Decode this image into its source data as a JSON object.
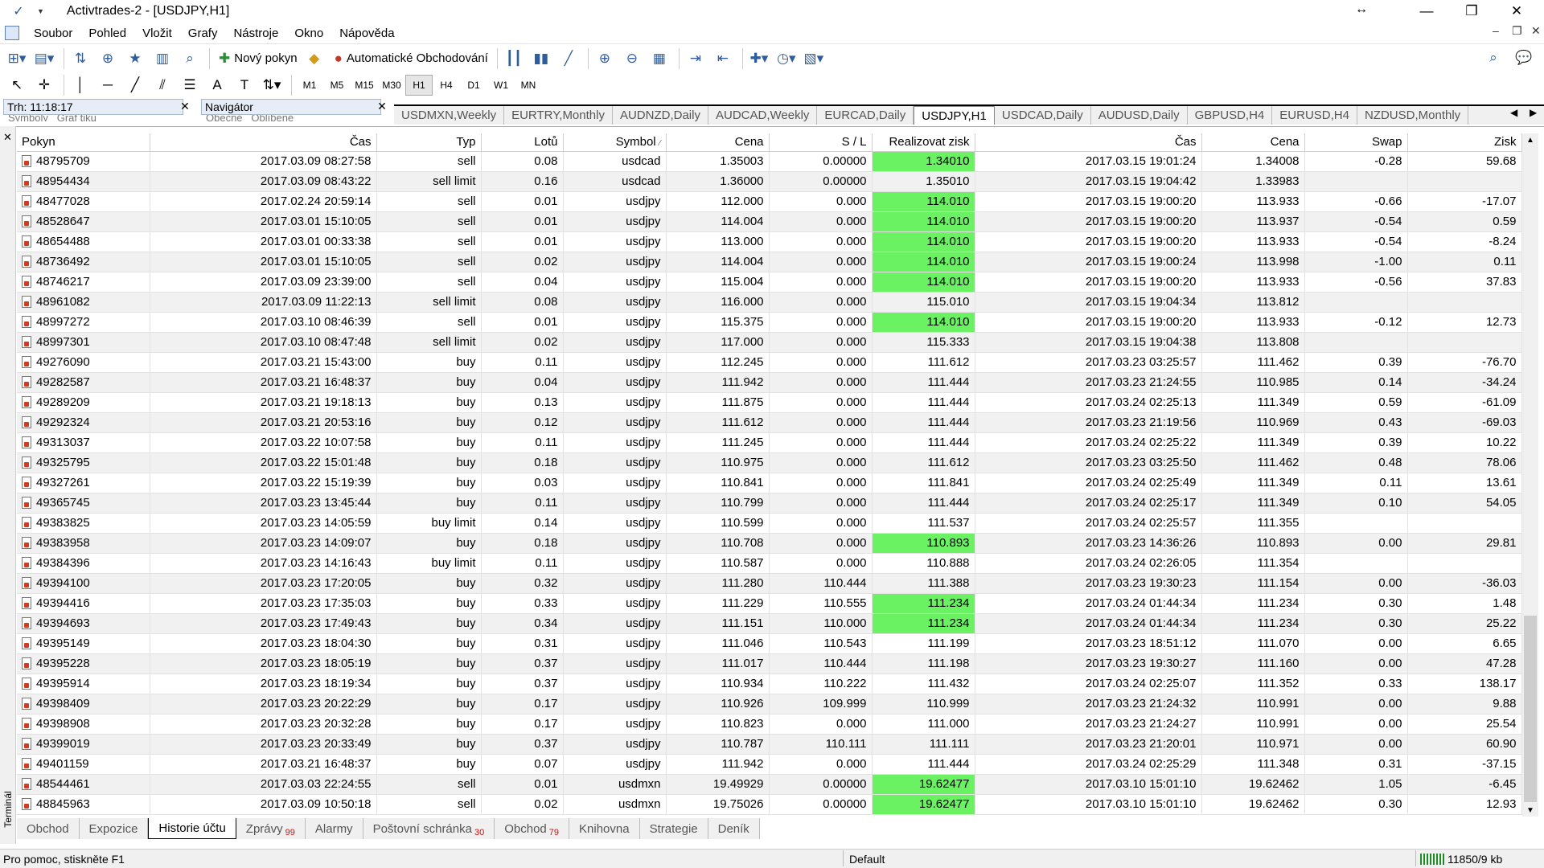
{
  "window": {
    "title": "Activtrades-2 - [USDJPY,H1]"
  },
  "menu": [
    "Soubor",
    "Pohled",
    "Vložit",
    "Grafy",
    "Nástroje",
    "Okno",
    "Nápověda"
  ],
  "toolbar": {
    "new_order": "Nový pokyn",
    "auto_trading": "Automatické Obchodování"
  },
  "timeframes": [
    "M1",
    "M5",
    "M15",
    "M30",
    "H1",
    "H4",
    "D1",
    "W1",
    "MN"
  ],
  "active_timeframe": "H1",
  "panels": {
    "market_watch": {
      "title": "Trh: 11:18:17",
      "tabs": [
        "Symboly",
        "Graf tiku"
      ]
    },
    "navigator": {
      "title": "Navigátor",
      "tabs": [
        "Obecné",
        "Oblíbené"
      ]
    }
  },
  "chart_tabs": [
    "USDMXN,Weekly",
    "EURTRY,Monthly",
    "AUDNZD,Daily",
    "AUDCAD,Weekly",
    "EURCAD,Daily",
    "USDJPY,H1",
    "USDCAD,Daily",
    "AUDUSD,Daily",
    "GBPUSD,H4",
    "EURUSD,H4",
    "NZDUSD,Monthly"
  ],
  "active_chart_tab": "USDJPY,H1",
  "table": {
    "headers": [
      "Pokyn",
      "Čas",
      "Typ",
      "Lotů",
      "Symbol",
      "Cena",
      "S / L",
      "Realizovat zisk",
      "Čas",
      "Cena",
      "Swap",
      "Zisk"
    ],
    "rows": [
      {
        "pokyn": "48795709",
        "cas": "2017.03.09 08:27:58",
        "typ": "sell",
        "lotu": "0.08",
        "symbol": "usdcad",
        "cena": "1.35003",
        "sl": "0.00000",
        "tp": "1.34010",
        "tp_hit": true,
        "cas2": "2017.03.15 19:01:24",
        "cena2": "1.34008",
        "swap": "-0.28",
        "zisk": "59.68"
      },
      {
        "pokyn": "48954434",
        "cas": "2017.03.09 08:43:22",
        "typ": "sell limit",
        "lotu": "0.16",
        "symbol": "usdcad",
        "cena": "1.36000",
        "sl": "0.00000",
        "tp": "1.35010",
        "tp_hit": false,
        "cas2": "2017.03.15 19:04:42",
        "cena2": "1.33983",
        "swap": "",
        "zisk": ""
      },
      {
        "pokyn": "48477028",
        "cas": "2017.02.24 20:59:14",
        "typ": "sell",
        "lotu": "0.01",
        "symbol": "usdjpy",
        "cena": "112.000",
        "sl": "0.000",
        "tp": "114.010",
        "tp_hit": true,
        "cas2": "2017.03.15 19:00:20",
        "cena2": "113.933",
        "swap": "-0.66",
        "zisk": "-17.07"
      },
      {
        "pokyn": "48528647",
        "cas": "2017.03.01 15:10:05",
        "typ": "sell",
        "lotu": "0.01",
        "symbol": "usdjpy",
        "cena": "114.004",
        "sl": "0.000",
        "tp": "114.010",
        "tp_hit": true,
        "cas2": "2017.03.15 19:00:20",
        "cena2": "113.937",
        "swap": "-0.54",
        "zisk": "0.59"
      },
      {
        "pokyn": "48654488",
        "cas": "2017.03.01 00:33:38",
        "typ": "sell",
        "lotu": "0.01",
        "symbol": "usdjpy",
        "cena": "113.000",
        "sl": "0.000",
        "tp": "114.010",
        "tp_hit": true,
        "cas2": "2017.03.15 19:00:20",
        "cena2": "113.933",
        "swap": "-0.54",
        "zisk": "-8.24"
      },
      {
        "pokyn": "48736492",
        "cas": "2017.03.01 15:10:05",
        "typ": "sell",
        "lotu": "0.02",
        "symbol": "usdjpy",
        "cena": "114.004",
        "sl": "0.000",
        "tp": "114.010",
        "tp_hit": true,
        "cas2": "2017.03.15 19:00:24",
        "cena2": "113.998",
        "swap": "-1.00",
        "zisk": "0.11"
      },
      {
        "pokyn": "48746217",
        "cas": "2017.03.09 23:39:00",
        "typ": "sell",
        "lotu": "0.04",
        "symbol": "usdjpy",
        "cena": "115.004",
        "sl": "0.000",
        "tp": "114.010",
        "tp_hit": true,
        "cas2": "2017.03.15 19:00:20",
        "cena2": "113.933",
        "swap": "-0.56",
        "zisk": "37.83"
      },
      {
        "pokyn": "48961082",
        "cas": "2017.03.09 11:22:13",
        "typ": "sell limit",
        "lotu": "0.08",
        "symbol": "usdjpy",
        "cena": "116.000",
        "sl": "0.000",
        "tp": "115.010",
        "tp_hit": false,
        "cas2": "2017.03.15 19:04:34",
        "cena2": "113.812",
        "swap": "",
        "zisk": ""
      },
      {
        "pokyn": "48997272",
        "cas": "2017.03.10 08:46:39",
        "typ": "sell",
        "lotu": "0.01",
        "symbol": "usdjpy",
        "cena": "115.375",
        "sl": "0.000",
        "tp": "114.010",
        "tp_hit": true,
        "cas2": "2017.03.15 19:00:20",
        "cena2": "113.933",
        "swap": "-0.12",
        "zisk": "12.73"
      },
      {
        "pokyn": "48997301",
        "cas": "2017.03.10 08:47:48",
        "typ": "sell limit",
        "lotu": "0.02",
        "symbol": "usdjpy",
        "cena": "117.000",
        "sl": "0.000",
        "tp": "115.333",
        "tp_hit": false,
        "cas2": "2017.03.15 19:04:38",
        "cena2": "113.808",
        "swap": "",
        "zisk": ""
      },
      {
        "pokyn": "49276090",
        "cas": "2017.03.21 15:43:00",
        "typ": "buy",
        "lotu": "0.11",
        "symbol": "usdjpy",
        "cena": "112.245",
        "sl": "0.000",
        "tp": "111.612",
        "tp_hit": false,
        "cas2": "2017.03.23 03:25:57",
        "cena2": "111.462",
        "swap": "0.39",
        "zisk": "-76.70"
      },
      {
        "pokyn": "49282587",
        "cas": "2017.03.21 16:48:37",
        "typ": "buy",
        "lotu": "0.04",
        "symbol": "usdjpy",
        "cena": "111.942",
        "sl": "0.000",
        "tp": "111.444",
        "tp_hit": false,
        "cas2": "2017.03.23 21:24:55",
        "cena2": "110.985",
        "swap": "0.14",
        "zisk": "-34.24"
      },
      {
        "pokyn": "49289209",
        "cas": "2017.03.21 19:18:13",
        "typ": "buy",
        "lotu": "0.13",
        "symbol": "usdjpy",
        "cena": "111.875",
        "sl": "0.000",
        "tp": "111.444",
        "tp_hit": false,
        "cas2": "2017.03.24 02:25:13",
        "cena2": "111.349",
        "swap": "0.59",
        "zisk": "-61.09"
      },
      {
        "pokyn": "49292324",
        "cas": "2017.03.21 20:53:16",
        "typ": "buy",
        "lotu": "0.12",
        "symbol": "usdjpy",
        "cena": "111.612",
        "sl": "0.000",
        "tp": "111.444",
        "tp_hit": false,
        "cas2": "2017.03.23 21:19:56",
        "cena2": "110.969",
        "swap": "0.43",
        "zisk": "-69.03"
      },
      {
        "pokyn": "49313037",
        "cas": "2017.03.22 10:07:58",
        "typ": "buy",
        "lotu": "0.11",
        "symbol": "usdjpy",
        "cena": "111.245",
        "sl": "0.000",
        "tp": "111.444",
        "tp_hit": false,
        "cas2": "2017.03.24 02:25:22",
        "cena2": "111.349",
        "swap": "0.39",
        "zisk": "10.22"
      },
      {
        "pokyn": "49325795",
        "cas": "2017.03.22 15:01:48",
        "typ": "buy",
        "lotu": "0.18",
        "symbol": "usdjpy",
        "cena": "110.975",
        "sl": "0.000",
        "tp": "111.612",
        "tp_hit": false,
        "cas2": "2017.03.23 03:25:50",
        "cena2": "111.462",
        "swap": "0.48",
        "zisk": "78.06"
      },
      {
        "pokyn": "49327261",
        "cas": "2017.03.22 15:19:39",
        "typ": "buy",
        "lotu": "0.03",
        "symbol": "usdjpy",
        "cena": "110.841",
        "sl": "0.000",
        "tp": "111.841",
        "tp_hit": false,
        "cas2": "2017.03.24 02:25:49",
        "cena2": "111.349",
        "swap": "0.11",
        "zisk": "13.61"
      },
      {
        "pokyn": "49365745",
        "cas": "2017.03.23 13:45:44",
        "typ": "buy",
        "lotu": "0.11",
        "symbol": "usdjpy",
        "cena": "110.799",
        "sl": "0.000",
        "tp": "111.444",
        "tp_hit": false,
        "cas2": "2017.03.24 02:25:17",
        "cena2": "111.349",
        "swap": "0.10",
        "zisk": "54.05"
      },
      {
        "pokyn": "49383825",
        "cas": "2017.03.23 14:05:59",
        "typ": "buy limit",
        "lotu": "0.14",
        "symbol": "usdjpy",
        "cena": "110.599",
        "sl": "0.000",
        "tp": "111.537",
        "tp_hit": false,
        "cas2": "2017.03.24 02:25:57",
        "cena2": "111.355",
        "swap": "",
        "zisk": ""
      },
      {
        "pokyn": "49383958",
        "cas": "2017.03.23 14:09:07",
        "typ": "buy",
        "lotu": "0.18",
        "symbol": "usdjpy",
        "cena": "110.708",
        "sl": "0.000",
        "tp": "110.893",
        "tp_hit": true,
        "cas2": "2017.03.23 14:36:26",
        "cena2": "110.893",
        "swap": "0.00",
        "zisk": "29.81"
      },
      {
        "pokyn": "49384396",
        "cas": "2017.03.23 14:16:43",
        "typ": "buy limit",
        "lotu": "0.11",
        "symbol": "usdjpy",
        "cena": "110.587",
        "sl": "0.000",
        "tp": "110.888",
        "tp_hit": false,
        "cas2": "2017.03.24 02:26:05",
        "cena2": "111.354",
        "swap": "",
        "zisk": ""
      },
      {
        "pokyn": "49394100",
        "cas": "2017.03.23 17:20:05",
        "typ": "buy",
        "lotu": "0.32",
        "symbol": "usdjpy",
        "cena": "111.280",
        "sl": "110.444",
        "tp": "111.388",
        "tp_hit": false,
        "cas2": "2017.03.23 19:30:23",
        "cena2": "111.154",
        "swap": "0.00",
        "zisk": "-36.03"
      },
      {
        "pokyn": "49394416",
        "cas": "2017.03.23 17:35:03",
        "typ": "buy",
        "lotu": "0.33",
        "symbol": "usdjpy",
        "cena": "111.229",
        "sl": "110.555",
        "tp": "111.234",
        "tp_hit": true,
        "cas2": "2017.03.24 01:44:34",
        "cena2": "111.234",
        "swap": "0.30",
        "zisk": "1.48"
      },
      {
        "pokyn": "49394693",
        "cas": "2017.03.23 17:49:43",
        "typ": "buy",
        "lotu": "0.34",
        "symbol": "usdjpy",
        "cena": "111.151",
        "sl": "110.000",
        "tp": "111.234",
        "tp_hit": true,
        "cas2": "2017.03.24 01:44:34",
        "cena2": "111.234",
        "swap": "0.30",
        "zisk": "25.22"
      },
      {
        "pokyn": "49395149",
        "cas": "2017.03.23 18:04:30",
        "typ": "buy",
        "lotu": "0.31",
        "symbol": "usdjpy",
        "cena": "111.046",
        "sl": "110.543",
        "tp": "111.199",
        "tp_hit": false,
        "cas2": "2017.03.23 18:51:12",
        "cena2": "111.070",
        "swap": "0.00",
        "zisk": "6.65"
      },
      {
        "pokyn": "49395228",
        "cas": "2017.03.23 18:05:19",
        "typ": "buy",
        "lotu": "0.37",
        "symbol": "usdjpy",
        "cena": "111.017",
        "sl": "110.444",
        "tp": "111.198",
        "tp_hit": false,
        "cas2": "2017.03.23 19:30:27",
        "cena2": "111.160",
        "swap": "0.00",
        "zisk": "47.28"
      },
      {
        "pokyn": "49395914",
        "cas": "2017.03.23 18:19:34",
        "typ": "buy",
        "lotu": "0.37",
        "symbol": "usdjpy",
        "cena": "110.934",
        "sl": "110.222",
        "tp": "111.432",
        "tp_hit": false,
        "cas2": "2017.03.24 02:25:07",
        "cena2": "111.352",
        "swap": "0.33",
        "zisk": "138.17"
      },
      {
        "pokyn": "49398409",
        "cas": "2017.03.23 20:22:29",
        "typ": "buy",
        "lotu": "0.17",
        "symbol": "usdjpy",
        "cena": "110.926",
        "sl": "109.999",
        "tp": "110.999",
        "tp_hit": false,
        "cas2": "2017.03.23 21:24:32",
        "cena2": "110.991",
        "swap": "0.00",
        "zisk": "9.88"
      },
      {
        "pokyn": "49398908",
        "cas": "2017.03.23 20:32:28",
        "typ": "buy",
        "lotu": "0.17",
        "symbol": "usdjpy",
        "cena": "110.823",
        "sl": "0.000",
        "tp": "111.000",
        "tp_hit": false,
        "cas2": "2017.03.23 21:24:27",
        "cena2": "110.991",
        "swap": "0.00",
        "zisk": "25.54"
      },
      {
        "pokyn": "49399019",
        "cas": "2017.03.23 20:33:49",
        "typ": "buy",
        "lotu": "0.37",
        "symbol": "usdjpy",
        "cena": "110.787",
        "sl": "110.111",
        "tp": "111.111",
        "tp_hit": false,
        "cas2": "2017.03.23 21:20:01",
        "cena2": "110.971",
        "swap": "0.00",
        "zisk": "60.90"
      },
      {
        "pokyn": "49401159",
        "cas": "2017.03.21 16:48:37",
        "typ": "buy",
        "lotu": "0.07",
        "symbol": "usdjpy",
        "cena": "111.942",
        "sl": "0.000",
        "tp": "111.444",
        "tp_hit": false,
        "cas2": "2017.03.24 02:25:29",
        "cena2": "111.348",
        "swap": "0.31",
        "zisk": "-37.15"
      },
      {
        "pokyn": "48544461",
        "cas": "2017.03.03 22:24:55",
        "typ": "sell",
        "lotu": "0.01",
        "symbol": "usdmxn",
        "cena": "19.49929",
        "sl": "0.00000",
        "tp": "19.62477",
        "tp_hit": true,
        "cas2": "2017.03.10 15:01:10",
        "cena2": "19.62462",
        "swap": "1.05",
        "zisk": "-6.45"
      },
      {
        "pokyn": "48845963",
        "cas": "2017.03.09 10:50:18",
        "typ": "sell",
        "lotu": "0.02",
        "symbol": "usdmxn",
        "cena": "19.75026",
        "sl": "0.00000",
        "tp": "19.62477",
        "tp_hit": true,
        "cas2": "2017.03.10 15:01:10",
        "cena2": "19.62462",
        "swap": "0.30",
        "zisk": "12.93"
      }
    ]
  },
  "bottom_tabs": [
    {
      "label": "Obchod",
      "count": ""
    },
    {
      "label": "Expozice",
      "count": ""
    },
    {
      "label": "Historie účtu",
      "count": ""
    },
    {
      "label": "Zprávy",
      "count": "99"
    },
    {
      "label": "Alarmy",
      "count": ""
    },
    {
      "label": "Poštovní schránka",
      "count": "30"
    },
    {
      "label": "Obchod",
      "count": "79"
    },
    {
      "label": "Knihovna",
      "count": ""
    },
    {
      "label": "Strategie",
      "count": ""
    },
    {
      "label": "Deník",
      "count": ""
    }
  ],
  "active_bottom_tab": "Historie účtu",
  "terminal_label": "Terminál",
  "status": {
    "help": "Pro pomoc, stiskněte F1",
    "profile": "Default",
    "traffic": "11850/9 kb"
  },
  "colors": {
    "tp_highlight": "#6af263",
    "tab_count": "#d01010"
  }
}
